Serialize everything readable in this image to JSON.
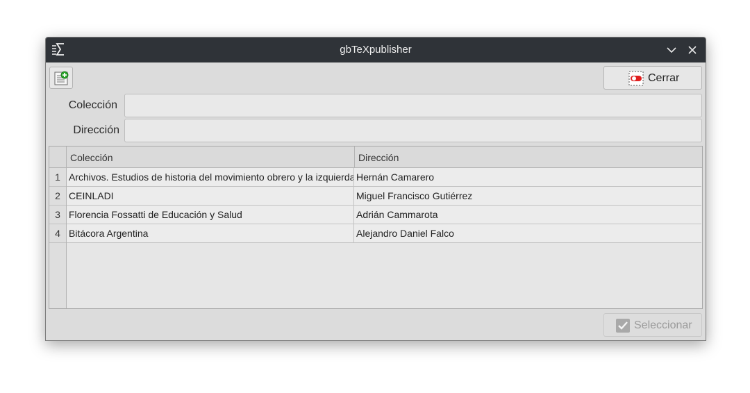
{
  "window": {
    "title": "gbTeXpublisher",
    "app_icon": "sigma-list-icon",
    "minimize_icon": "chevron-down-icon",
    "close_icon": "close-icon"
  },
  "toolbar": {
    "new_icon": "document-add-icon",
    "close_label": "Cerrar",
    "close_icon": "exit-toggle-icon"
  },
  "form": {
    "coleccion_label": "Colección",
    "coleccion_value": "",
    "direccion_label": "Dirección",
    "direccion_value": ""
  },
  "table": {
    "columns": [
      "Colección",
      "Dirección"
    ],
    "rows": [
      {
        "num": "1",
        "coleccion": "Archivos. Estudios de historia del movimiento obrero y la izquierda",
        "direccion": "Hernán Camarero"
      },
      {
        "num": "2",
        "coleccion": "CEINLADI",
        "direccion": "Miguel Francisco Gutiérrez"
      },
      {
        "num": "3",
        "coleccion": "Florencia Fossatti de Educación y Salud",
        "direccion": "Adrián Cammarota"
      },
      {
        "num": "4",
        "coleccion": "Bitácora Argentina",
        "direccion": "Alejandro Daniel Falco"
      }
    ]
  },
  "footer": {
    "select_label": "Seleccionar",
    "select_icon": "checkmark-icon",
    "select_enabled": false
  },
  "colors": {
    "titlebar": "#2f3338",
    "window_bg": "#dcdcdc",
    "close_red": "#e02020",
    "new_green": "#2aa52a"
  }
}
